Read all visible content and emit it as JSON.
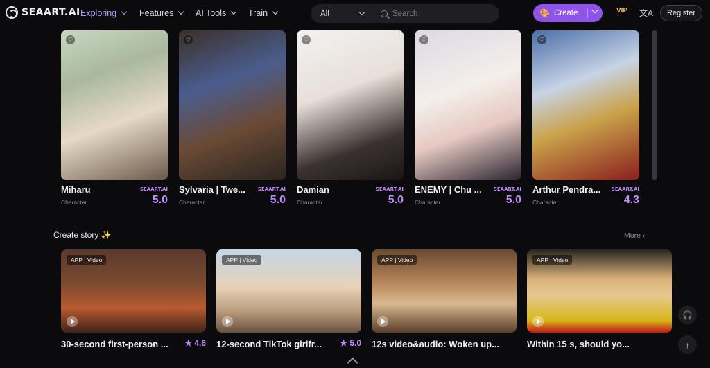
{
  "brand": {
    "name": "SEAART.AI"
  },
  "nav": [
    {
      "label": "Exploring"
    },
    {
      "label": "Features"
    },
    {
      "label": "AI Tools"
    },
    {
      "label": "Train"
    }
  ],
  "search": {
    "category": "All",
    "placeholder": "Search"
  },
  "actions": {
    "create_label": "Create",
    "vip_label": "VIP",
    "register_label": "Register"
  },
  "characters": [
    {
      "name": "Miharu",
      "type": "Character",
      "brand": "SEAART.AI",
      "rating": "5.0"
    },
    {
      "name": "Sylvaria | Twe...",
      "type": "Character",
      "brand": "SEAART.AI",
      "rating": "5.0"
    },
    {
      "name": "Damian",
      "type": "Character",
      "brand": "SEAART.AI",
      "rating": "5.0"
    },
    {
      "name": "ENEMY | Chu ...",
      "type": "Character",
      "brand": "SEAART.AI",
      "rating": "5.0"
    },
    {
      "name": "Arthur Pendra...",
      "type": "Character",
      "brand": "SEAART.AI",
      "rating": "4.3"
    }
  ],
  "story": {
    "title": "Create story",
    "more_label": "More"
  },
  "stories": [
    {
      "tag": "APP | Video",
      "title": "30-second first-person ...",
      "rating": "4.6"
    },
    {
      "tag": "APP | Video",
      "title": "12-second TikTok girlfr...",
      "rating": "5.0"
    },
    {
      "tag": "APP | Video",
      "title": "12s video&audio: Woken up...",
      "rating": ""
    },
    {
      "tag": "APP | Video",
      "title": "Within 15 s, should yo...",
      "rating": ""
    }
  ],
  "colors": {
    "accent": "#8e54e9",
    "rating": "#c08aff",
    "background": "#0b0b0d"
  }
}
